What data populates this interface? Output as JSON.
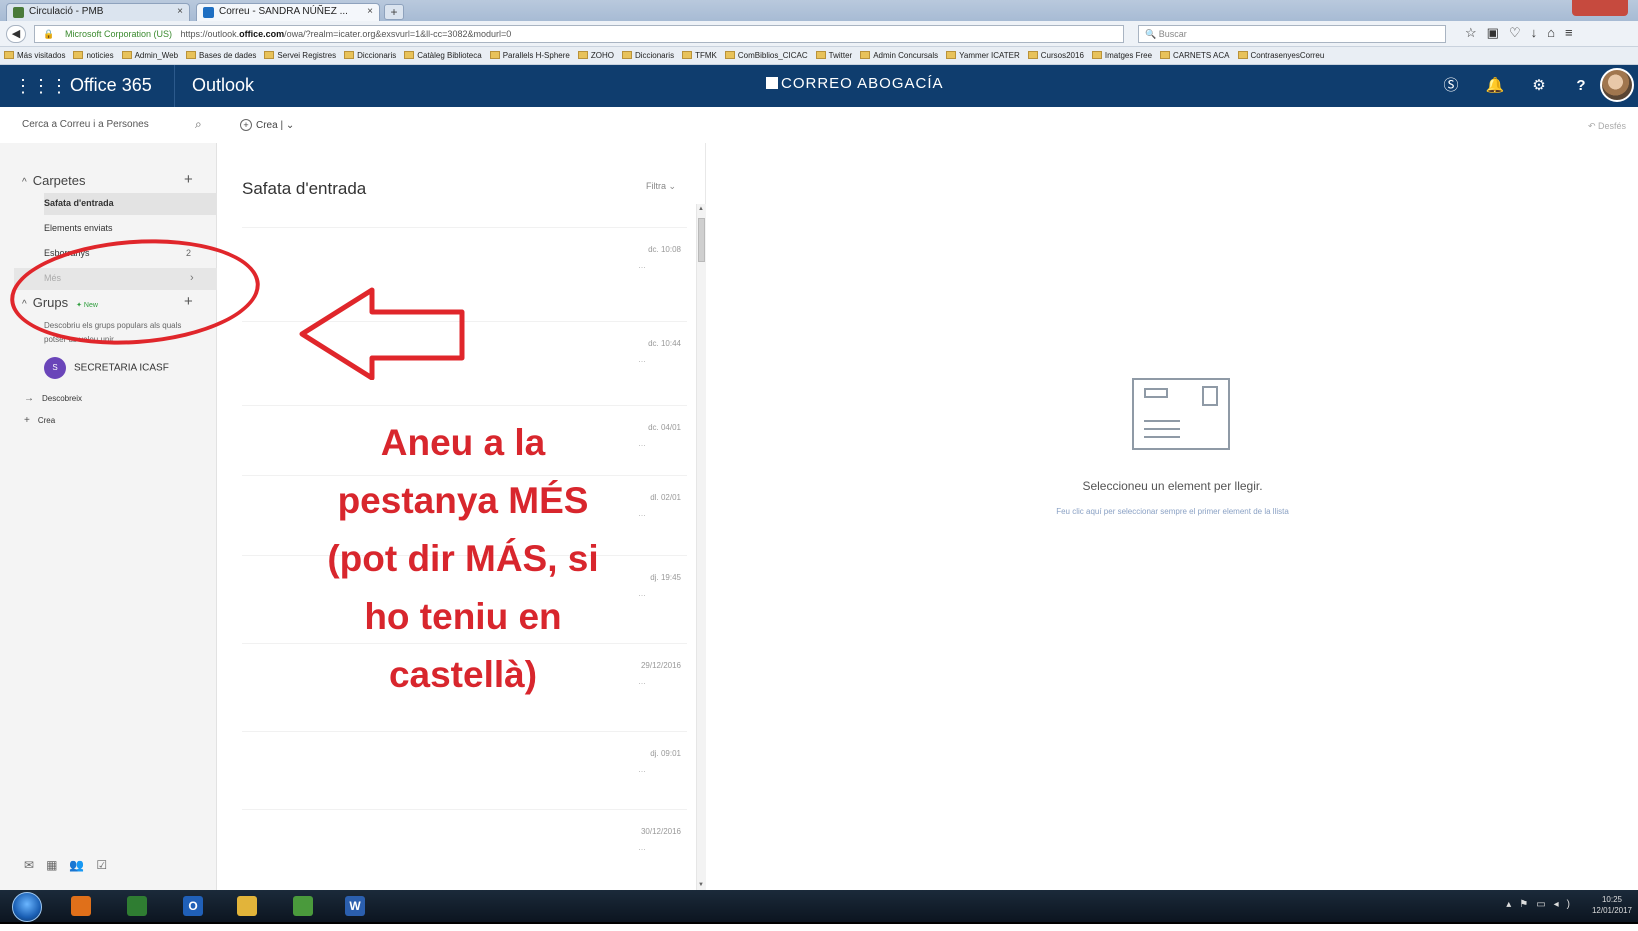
{
  "browser": {
    "tabs": [
      {
        "label": "Circulació - PMB"
      },
      {
        "label": "Correu - SANDRA NÚÑEZ ..."
      }
    ],
    "new_tab": "+",
    "address": {
      "org": "Microsoft Corporation (US)",
      "url_prefix": "https://outlook.",
      "url_domain": "office.com",
      "url_suffix": "/owa/?realm=icater.org&exsvurl=1&ll-cc=3082&modurl=0"
    },
    "search_placeholder": "Buscar",
    "bookmarks": [
      "Más visitados",
      "noticies",
      "Admin_Web",
      "Bases de dades",
      "Servei Registres",
      "Diccionaris",
      "Catàleg Biblioteca",
      "Parallels H-Sphere",
      "ZOHO",
      "Diccionaris",
      "TFMK",
      "ComBiblios_CICAC",
      "Twitter",
      "Admin Concursals",
      "Yammer ICATER",
      "Cursos2016",
      "Imatges Free",
      "CARNETS ACA",
      "ContrasenyesCorreu"
    ]
  },
  "header": {
    "suite": "Office 365",
    "app": "Outlook",
    "brand": "CORREO ABOGACÍA",
    "icons": [
      "skype-icon",
      "bell-icon",
      "gear-icon",
      "help-icon"
    ],
    "help_glyph": "?"
  },
  "command": {
    "search_placeholder": "Cerca a Correu i a Persones",
    "new_label": "Crea",
    "undo_label": "Desfés"
  },
  "folders": {
    "header": "Carpetes",
    "items": [
      {
        "label": "Safata d'entrada",
        "count": ""
      },
      {
        "label": "Elements enviats",
        "count": ""
      },
      {
        "label": "Esborranys",
        "count": "2"
      }
    ],
    "more_label": "Més"
  },
  "groups": {
    "header": "Grups",
    "badge": "New",
    "description": "Descobriu els grups populars als quals potser us voleu unir.",
    "items": [
      {
        "label": "SECRETARIA ICASF",
        "initial": "S"
      }
    ],
    "discover_label": "Descobreix",
    "create_label": "Crea"
  },
  "message_list": {
    "title": "Safata d'entrada",
    "filter_label": "Filtra",
    "dates": [
      "dc. 10:08",
      "dc. 10:44",
      "dc. 04/01",
      "dl. 02/01",
      "dj. 19:45",
      "29/12/2016",
      "dj. 09:01",
      "30/12/2016"
    ]
  },
  "reading_pane": {
    "main": "Seleccioneu un element per llegir.",
    "sub": "Feu clic aquí per seleccionar sempre el primer element de la llista"
  },
  "annotation": {
    "text": "Aneu a la\npestanya MÉS\n(pot dir MÁS, si\nho teniu en\ncastellà)",
    "color": "#d8262d"
  },
  "taskbar": {
    "apps": [
      {
        "name": "firefox",
        "color": "#e0701a",
        "glyph": ""
      },
      {
        "name": "media-center",
        "color": "#2f7d32",
        "glyph": ""
      },
      {
        "name": "outlook",
        "color": "#2060b8",
        "glyph": "O"
      },
      {
        "name": "explorer",
        "color": "#e2b43a",
        "glyph": ""
      },
      {
        "name": "chrome",
        "color": "#4a9a3c",
        "glyph": ""
      },
      {
        "name": "word",
        "color": "#2b5fae",
        "glyph": "W"
      }
    ],
    "clock_time": "10:25",
    "clock_date": "12/01/2017"
  }
}
